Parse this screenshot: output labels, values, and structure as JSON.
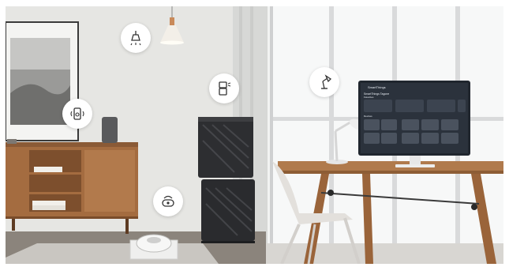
{
  "scene": {
    "smart_tv": {
      "app_brand": "SmartThings",
      "title": "SmartThings Tagone",
      "subtitle": "Favorites",
      "devices_label": "Devices"
    },
    "device_icons": [
      "ceiling-light-icon",
      "air-purifier-icon",
      "desk-lamp-icon",
      "smart-speaker-icon",
      "robot-vacuum-icon"
    ]
  }
}
